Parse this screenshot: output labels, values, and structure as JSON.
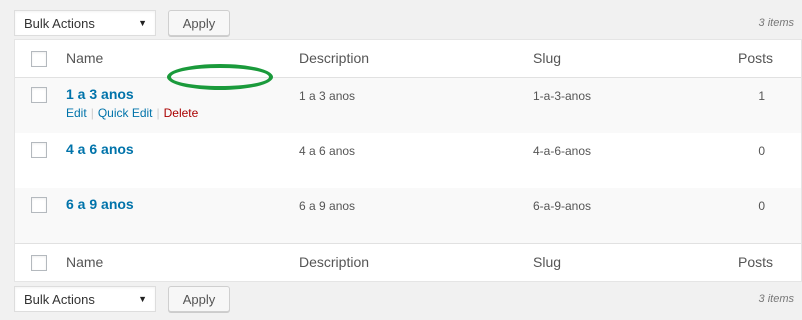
{
  "nav_top": {
    "bulk_label": "Bulk Actions",
    "apply_label": "Apply",
    "count": "3 items"
  },
  "nav_bottom": {
    "bulk_label": "Bulk Actions",
    "apply_label": "Apply",
    "count": "3 items"
  },
  "columns": {
    "name": "Name",
    "description": "Description",
    "slug": "Slug",
    "posts": "Posts"
  },
  "rows": [
    {
      "name": "1 a 3 anos",
      "description": "1 a 3 anos",
      "slug": "1-a-3-anos",
      "posts": "1"
    },
    {
      "name": "4 a 6 anos",
      "description": "4 a 6 anos",
      "slug": "4-a-6-anos",
      "posts": "0"
    },
    {
      "name": "6 a 9 anos",
      "description": "6 a 9 anos",
      "slug": "6-a-9-anos",
      "posts": "0"
    }
  ],
  "row_actions": {
    "edit": "Edit",
    "quick_edit": "Quick Edit",
    "delete": "Delete",
    "separator": "|"
  },
  "colors": {
    "link": "#0073aa",
    "delete": "#aa0000",
    "highlight_ring": "#1a9a3b"
  },
  "icons": {
    "dropdown": "caret-down-icon"
  }
}
